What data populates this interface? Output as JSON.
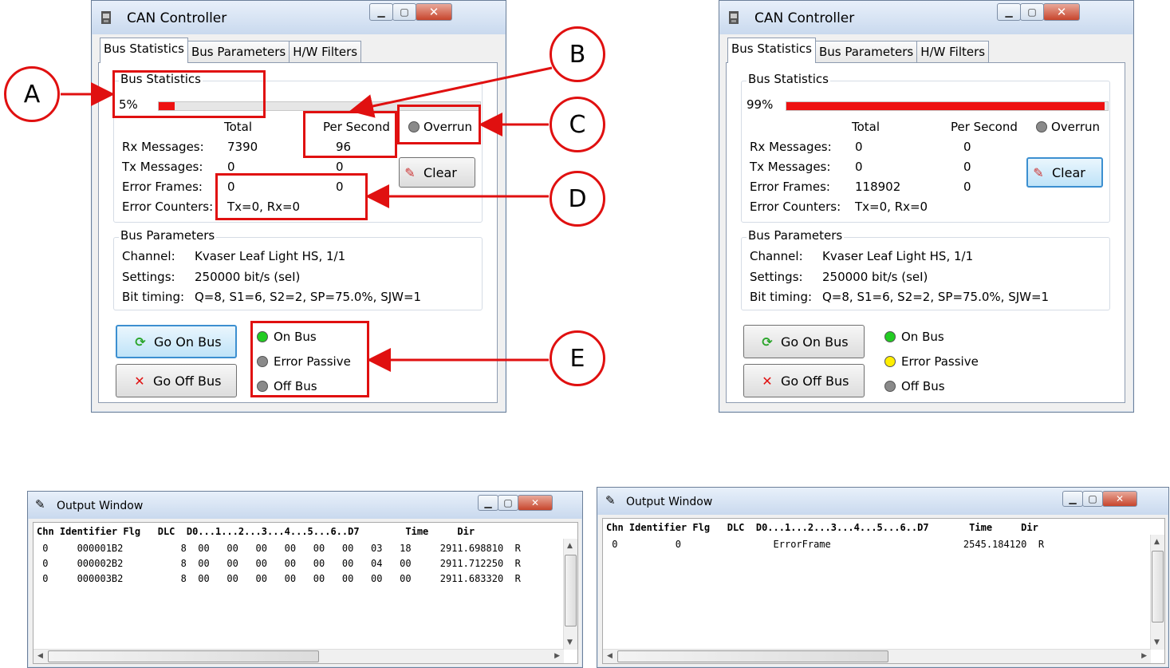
{
  "colors": {
    "annotation_red": "#e01010",
    "bar_red": "#ee1111",
    "led_green": "#22cc22",
    "led_yellow": "#ffee00",
    "led_gray": "#8a8a8a"
  },
  "can_left": {
    "title": "CAN Controller",
    "tabs": [
      "Bus Statistics",
      "Bus Parameters",
      "H/W Filters"
    ],
    "stats_group": "Bus Statistics",
    "load_label": "5%",
    "load_fraction": 0.05,
    "col_total": "Total",
    "col_per_second": "Per Second",
    "overrun": "Overrun",
    "rx_label": "Rx Messages:",
    "rx_total": "7390",
    "rx_ps": "96",
    "tx_label": "Tx Messages:",
    "tx_total": "0",
    "tx_ps": "0",
    "err_label": "Error Frames:",
    "err_total": "0",
    "err_ps": "0",
    "cnt_label": "Error Counters:",
    "cnt_value": "Tx=0, Rx=0",
    "clear": "Clear",
    "params_group": "Bus Parameters",
    "channel_label": "Channel:",
    "channel": "Kvaser Leaf Light HS, 1/1",
    "settings_label": "Settings:",
    "settings": "250000 bit/s (seI)",
    "timing_label": "Bit timing:",
    "timing": "Q=8, S1=6, S2=2, SP=75.0%, SJW=1",
    "go_on": "Go On Bus",
    "go_off": "Go Off Bus",
    "on_bus": "On Bus",
    "error_passive": "Error Passive",
    "off_bus": "Off Bus"
  },
  "can_right": {
    "title": "CAN Controller",
    "tabs": [
      "Bus Statistics",
      "Bus Parameters",
      "H/W Filters"
    ],
    "stats_group": "Bus Statistics",
    "load_label": "99%",
    "load_fraction": 0.99,
    "col_total": "Total",
    "col_per_second": "Per Second",
    "overrun": "Overrun",
    "rx_label": "Rx Messages:",
    "rx_total": "0",
    "rx_ps": "0",
    "tx_label": "Tx Messages:",
    "tx_total": "0",
    "tx_ps": "0",
    "err_label": "Error Frames:",
    "err_total": "118902",
    "err_ps": "0",
    "cnt_label": "Error Counters:",
    "cnt_value": "Tx=0, Rx=0",
    "clear": "Clear",
    "params_group": "Bus Parameters",
    "channel_label": "Channel:",
    "channel": "Kvaser Leaf Light HS, 1/1",
    "settings_label": "Settings:",
    "settings": "250000 bit/s (seI)",
    "timing_label": "Bit timing:",
    "timing": "Q=8, S1=6, S2=2, SP=75.0%, SJW=1",
    "go_on": "Go On Bus",
    "go_off": "Go Off Bus",
    "on_bus": "On Bus",
    "error_passive": "Error Passive",
    "off_bus": "Off Bus"
  },
  "annotations": {
    "a": "A",
    "b": "B",
    "c": "C",
    "d": "D",
    "e": "E"
  },
  "output_left": {
    "title": "Output Window",
    "header": "Chn Identifier Flg   DLC  D0...1...2...3...4...5...6..D7        Time     Dir",
    "rows": [
      " 0     000001B2          8  00   00   00   00   00   00   03   18     2911.698810  R",
      " 0     000002B2          8  00   00   00   00   00   00   04   00     2911.712250  R",
      " 0     000003B2          8  00   00   00   00   00   00   00   00     2911.683320  R"
    ]
  },
  "output_right": {
    "title": "Output Window",
    "header": "Chn Identifier Flg   DLC  D0...1...2...3...4...5...6..D7       Time     Dir",
    "rows": [
      " 0          0                ErrorFrame                       2545.184120  R"
    ]
  }
}
